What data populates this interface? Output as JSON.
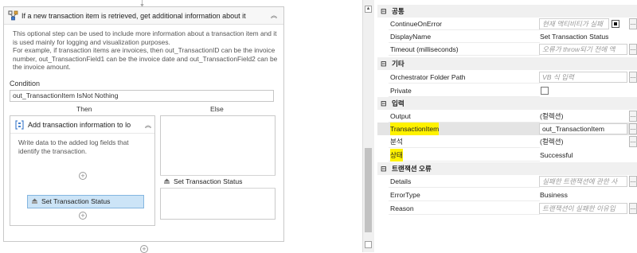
{
  "designer": {
    "outer_activity": {
      "title": "If a new transaction item is retrieved, get additional information about it",
      "description": "This optional step can be used to include more information about a transaction item and it is used mainly for logging and visualization purposes.\nFor example, if transaction items are invoices, then out_TransactionID can be the invoice number, out_TransactionField1 can be the invoice date and out_TransactionField2 can be the invoice amount.",
      "collapse_icon": "double-chevron-up-icon"
    },
    "condition": {
      "label": "Condition",
      "value": "out_TransactionItem IsNot Nothing"
    },
    "then_label": "Then",
    "else_label": "Else",
    "then_sequence": {
      "title": "Add transaction information to lo",
      "description": "Write data to the added log fields that identify the transaction.",
      "activity": "Set Transaction Status"
    },
    "else_activity": "Set Transaction Status"
  },
  "properties": {
    "categories": [
      {
        "name": "공통",
        "rows": [
          {
            "name": "ContinueOnError",
            "value": "현재 액티비티가 실패",
            "placeholder": true,
            "type": "input",
            "extra": "square"
          },
          {
            "name": "DisplayName",
            "value": "Set Transaction Status",
            "placeholder": false,
            "type": "text"
          },
          {
            "name": "Timeout (milliseconds)",
            "value": "오류가 throw되기 전에 액",
            "placeholder": true,
            "type": "input"
          }
        ]
      },
      {
        "name": "기타",
        "rows": [
          {
            "name": "Orchestrator Folder Path",
            "value": "VB 식 입력",
            "placeholder": true,
            "type": "input"
          },
          {
            "name": "Private",
            "value": "",
            "placeholder": false,
            "type": "checkbox"
          }
        ]
      },
      {
        "name": "입력",
        "rows": [
          {
            "name": "Output",
            "value": "(컬렉션)",
            "placeholder": false,
            "type": "text",
            "button": true
          },
          {
            "name": "TransactionItem",
            "value": "out_TransactionItem",
            "placeholder": false,
            "type": "input",
            "highlight": true,
            "selected": true
          },
          {
            "name": "분석",
            "value": "(컬렉션)",
            "placeholder": false,
            "type": "text",
            "button": true
          },
          {
            "name": "상태",
            "value": "Successful",
            "placeholder": false,
            "type": "text",
            "highlight": true
          }
        ]
      },
      {
        "name": "트랜잭션 오류",
        "rows": [
          {
            "name": "Details",
            "value": "실패한 트랜잭션에 관한 사",
            "placeholder": true,
            "type": "input"
          },
          {
            "name": "ErrorType",
            "value": "Business",
            "placeholder": false,
            "type": "text"
          },
          {
            "name": "Reason",
            "value": "트랜잭션이 실패한 이유입",
            "placeholder": true,
            "type": "input"
          }
        ]
      }
    ],
    "toggle_symbol": "⊟",
    "ellipsis": "...",
    "highlight_color": "#fff200"
  },
  "icons": {
    "then_activity_icon": "set-status-icon",
    "else_activity_icon": "set-status-icon",
    "outer_icon": "if-activity-icon",
    "then_icon": "sequence-icon"
  }
}
